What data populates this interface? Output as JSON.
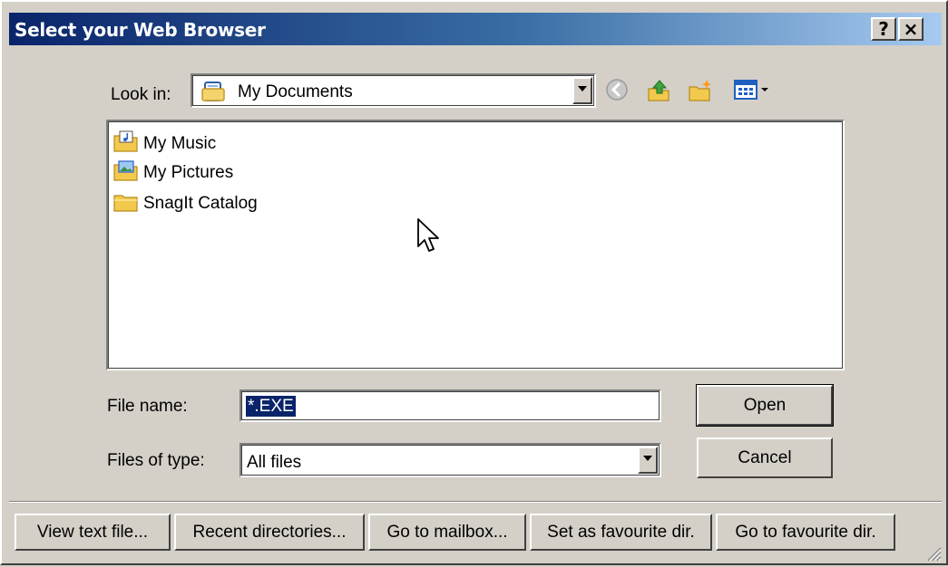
{
  "window": {
    "title": "Select your Web Browser",
    "help_label": "?",
    "close_label": "×"
  },
  "look_in": {
    "label": "Look in:",
    "value": "My Documents",
    "icons": [
      "my-documents-icon",
      "back-icon",
      "up-folder-icon",
      "new-folder-icon",
      "view-menu-icon"
    ]
  },
  "files": [
    {
      "name": "My Music",
      "icon": "music-folder-icon"
    },
    {
      "name": "My Pictures",
      "icon": "pictures-folder-icon"
    },
    {
      "name": "SnagIt Catalog",
      "icon": "folder-icon"
    }
  ],
  "file_name": {
    "label": "File name:",
    "value": "*.EXE"
  },
  "file_type": {
    "label": "Files of type:",
    "value": "All files"
  },
  "buttons": {
    "open": "Open",
    "cancel": "Cancel"
  },
  "bottom_buttons": [
    "View text file...",
    "Recent directories...",
    "Go to mailbox...",
    "Set as favourite dir.",
    "Go to favourite dir."
  ]
}
